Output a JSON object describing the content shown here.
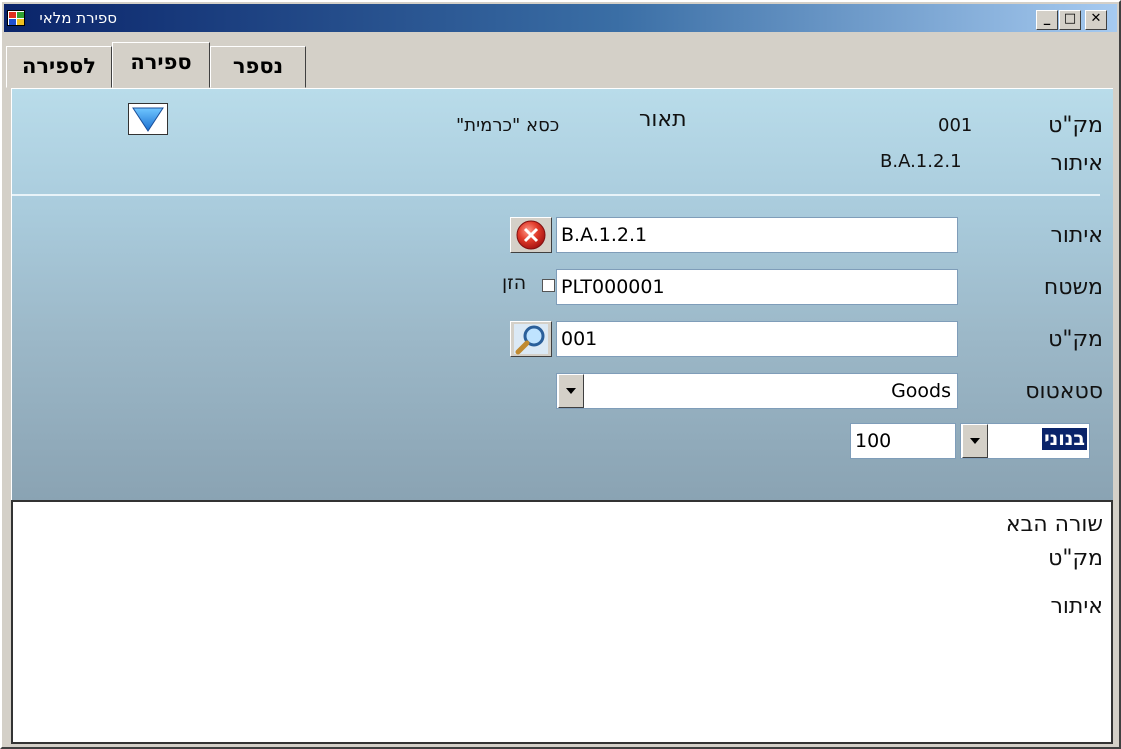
{
  "window": {
    "title": "ספירת מלאי",
    "minimize_glyph": "_",
    "maximize_glyph": "□",
    "close_glyph": "✕"
  },
  "tabs": [
    {
      "label": "לספירה"
    },
    {
      "label": "ספירה"
    },
    {
      "label": "נספר"
    }
  ],
  "header": {
    "sku_label": "מק\"ט",
    "sku_value": "001",
    "description_label": "תאור",
    "description_value": "\"כסא \"כרמית",
    "location_label": "איתור",
    "location_value": "B.A.1.2.1"
  },
  "form": {
    "location_label": "איתור",
    "location_value": "B.A.1.2.1",
    "pallet_label": "משטח",
    "pallet_value": "PLT000001",
    "feed_checkbox_label": "הזן",
    "sku_label": "מק\"ט",
    "sku_value": "001",
    "status_label": "סטאטוס",
    "status_value": "Goods",
    "grade_value": "בנוני",
    "quantity_value": "100"
  },
  "next_row": {
    "title": "שורה הבא",
    "sku_label": "מק\"ט",
    "location_label": "איתור"
  },
  "colors": {
    "titlebar_start": "#0a246a",
    "panel_top": "#b9dcea",
    "panel_bottom": "#8aa3b3",
    "selection": "#0a246a"
  }
}
